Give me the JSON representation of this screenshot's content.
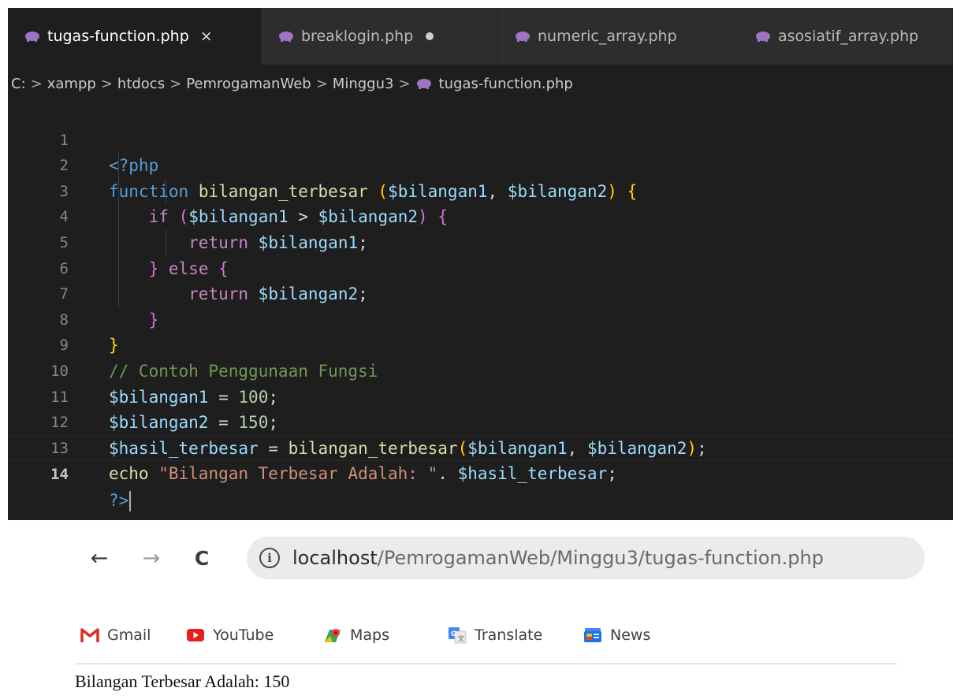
{
  "tabs": [
    {
      "label": "tugas-function.php",
      "active": true,
      "control": "×"
    },
    {
      "label": "breaklogin.php",
      "active": false,
      "modified": true
    },
    {
      "label": "numeric_array.php",
      "active": false
    },
    {
      "label": "asosiatif_array.php",
      "active": false
    }
  ],
  "breadcrumb": {
    "parts": [
      "C:",
      "xampp",
      "htdocs",
      "PemrogamanWeb",
      "Minggu3"
    ],
    "separator": ">",
    "file": "tugas-function.php"
  },
  "code": {
    "line_numbers": [
      "1",
      "2",
      "3",
      "4",
      "5",
      "6",
      "7",
      "8",
      "9",
      "10",
      "11",
      "12",
      "13",
      "14"
    ],
    "current_line": 14,
    "l1": {
      "tag": "<?php"
    },
    "l2": {
      "kw": "function",
      "name": "bilangan_terbesar",
      "open_paren": "(",
      "p1": "$bilangan1",
      "comma": ",",
      "p2": "$bilangan2",
      "close_paren": ")",
      "brace": "{"
    },
    "l3": {
      "kw": "if",
      "open_paren": "(",
      "a": "$bilangan1",
      "op": ">",
      "b": "$bilangan2",
      "close_paren": ")",
      "brace": "{"
    },
    "l4": {
      "kw": "return",
      "v": "$bilangan1",
      "semi": ";"
    },
    "l5": {
      "close": "}",
      "kw": "else",
      "brace": "{"
    },
    "l6": {
      "kw": "return",
      "v": "$bilangan2",
      "semi": ";"
    },
    "l7": {
      "close": "}"
    },
    "l8": {
      "close": "}"
    },
    "l9": {
      "comment": "// Contoh Penggunaan Fungsi"
    },
    "l10": {
      "v": "$bilangan1",
      "eq": "=",
      "num": "100",
      "semi": ";"
    },
    "l11": {
      "v": "$bilangan2",
      "eq": "=",
      "num": "150",
      "semi": ";"
    },
    "l12": {
      "v": "$hasil_terbesar",
      "eq": "=",
      "fn": "bilangan_terbesar",
      "open_paren": "(",
      "a": "$bilangan1",
      "comma": ",",
      "b": "$bilangan2",
      "close_paren": ")",
      "semi": ";"
    },
    "l13": {
      "kw": "echo",
      "str": "\"Bilangan Terbesar Adalah: \"",
      "dot": ".",
      "v": "$hasil_terbesar",
      "semi": ";"
    },
    "l14": {
      "tag": "?>"
    }
  },
  "syntax_colors": {
    "background": "#1e1e1e",
    "keyword": "#569cd6",
    "control": "#c586c0",
    "function": "#dcdcaa",
    "variable": "#9cdcfe",
    "number": "#b5cea8",
    "string": "#ce9178",
    "comment": "#6a9955",
    "bracket1": "#ffd700",
    "bracket2": "#da70d6"
  },
  "browser": {
    "back_icon": "←",
    "forward_icon": "→",
    "reload_icon": "C",
    "info_icon": "i",
    "url_host": "localhost",
    "url_path": "/PemrogamanWeb/Minggu3/tugas-function.php",
    "bookmarks": [
      {
        "label": "Gmail",
        "icon": "gmail-icon"
      },
      {
        "label": "YouTube",
        "icon": "youtube-icon"
      },
      {
        "label": "Maps",
        "icon": "maps-icon"
      },
      {
        "label": "Translate",
        "icon": "translate-icon"
      },
      {
        "label": "News",
        "icon": "news-icon"
      }
    ],
    "output": "Bilangan Terbesar Adalah: 150"
  }
}
